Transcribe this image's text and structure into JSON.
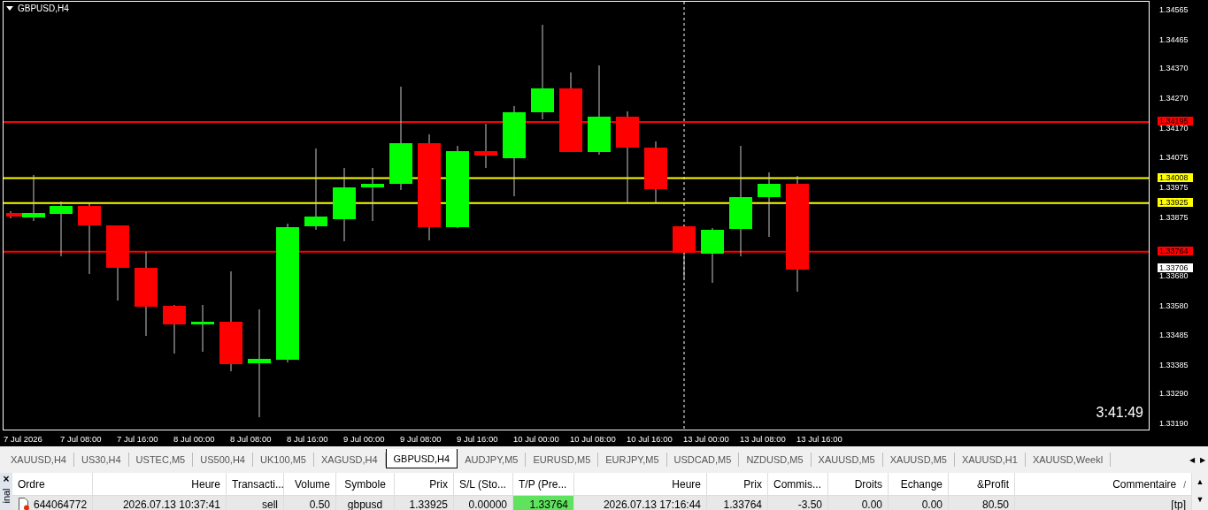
{
  "chart": {
    "title": "GBPUSD,H4",
    "countdown": "3:41:49",
    "price_ticks": [
      "1.34565",
      "1.34465",
      "1.34370",
      "1.34270",
      "1.34170",
      "1.34075",
      "1.33975",
      "1.33875",
      "1.33680",
      "1.33580",
      "1.33485",
      "1.33385",
      "1.33290",
      "1.33190"
    ],
    "levels": [
      {
        "price": "1.34195",
        "color": "#ff0000",
        "kind": "level"
      },
      {
        "price": "1.34008",
        "color": "#ffff00",
        "kind": "level"
      },
      {
        "price": "1.33925",
        "color": "#ffff00",
        "kind": "level"
      },
      {
        "price": "1.33764",
        "color": "#ff0000",
        "kind": "level"
      },
      {
        "price": "1.33706",
        "color": "#ffffff",
        "kind": "current"
      }
    ],
    "time_labels": [
      "7 Jul 2026",
      "7 Jul 08:00",
      "7 Jul 16:00",
      "8 Jul 00:00",
      "8 Jul 08:00",
      "8 Jul 16:00",
      "9 Jul 00:00",
      "9 Jul 08:00",
      "9 Jul 16:00",
      "10 Jul 00:00",
      "10 Jul 08:00",
      "10 Jul 16:00",
      "13 Jul 00:00",
      "13 Jul 08:00",
      "13 Jul 16:00"
    ]
  },
  "tabs": [
    {
      "label": "XAUUSD,H4",
      "selected": false
    },
    {
      "label": "US30,H4",
      "selected": false
    },
    {
      "label": "USTEC,M5",
      "selected": false
    },
    {
      "label": "US500,H4",
      "selected": false
    },
    {
      "label": "UK100,M5",
      "selected": false
    },
    {
      "label": "XAGUSD,H4",
      "selected": false
    },
    {
      "label": "GBPUSD,H4",
      "selected": true
    },
    {
      "label": "AUDJPY,M5",
      "selected": false
    },
    {
      "label": "EURUSD,M5",
      "selected": false
    },
    {
      "label": "EURJPY,M5",
      "selected": false
    },
    {
      "label": "USDCAD,M5",
      "selected": false
    },
    {
      "label": "NZDUSD,M5",
      "selected": false
    },
    {
      "label": "XAUUSD,M5",
      "selected": false
    },
    {
      "label": "XAUUSD,M5",
      "selected": false
    },
    {
      "label": "XAUUSD,H1",
      "selected": false
    },
    {
      "label": "XAUUSD,Weekl",
      "selected": false
    }
  ],
  "tab_scroll": [
    "◀",
    "▶"
  ],
  "terminal": {
    "close": "×",
    "side_label": "inal",
    "columns": [
      "Ordre",
      "Heure",
      "Transacti...",
      "Volume",
      "Symbole",
      "Prix",
      "S/L (Sto...",
      "T/P (Pre...",
      "Heure",
      "Prix",
      "Commis...",
      "Droits",
      "Echange",
      "&Profit",
      "Commentaire"
    ],
    "sort_mark": "/",
    "rows": [
      {
        "cells": [
          {
            "text": "644064772",
            "highlighted": false
          },
          {
            "text": "2026.07.13 10:37:41",
            "highlighted": false
          },
          {
            "text": "sell",
            "highlighted": false
          },
          {
            "text": "0.50",
            "highlighted": false
          },
          {
            "text": "gbpusd",
            "highlighted": false
          },
          {
            "text": "1.33925",
            "highlighted": false
          },
          {
            "text": "0.00000",
            "highlighted": false
          },
          {
            "text": "1.33764",
            "highlighted": true
          },
          {
            "text": "2026.07.13 17:16:44",
            "highlighted": false
          },
          {
            "text": "1.33764",
            "highlighted": false
          },
          {
            "text": "-3.50",
            "highlighted": false
          },
          {
            "text": "0.00",
            "highlighted": false
          },
          {
            "text": "0.00",
            "highlighted": false
          },
          {
            "text": "80.50",
            "highlighted": false
          },
          {
            "text": "[tp]",
            "highlighted": false
          }
        ]
      }
    ],
    "scroll": [
      "▲",
      "▼"
    ]
  }
}
